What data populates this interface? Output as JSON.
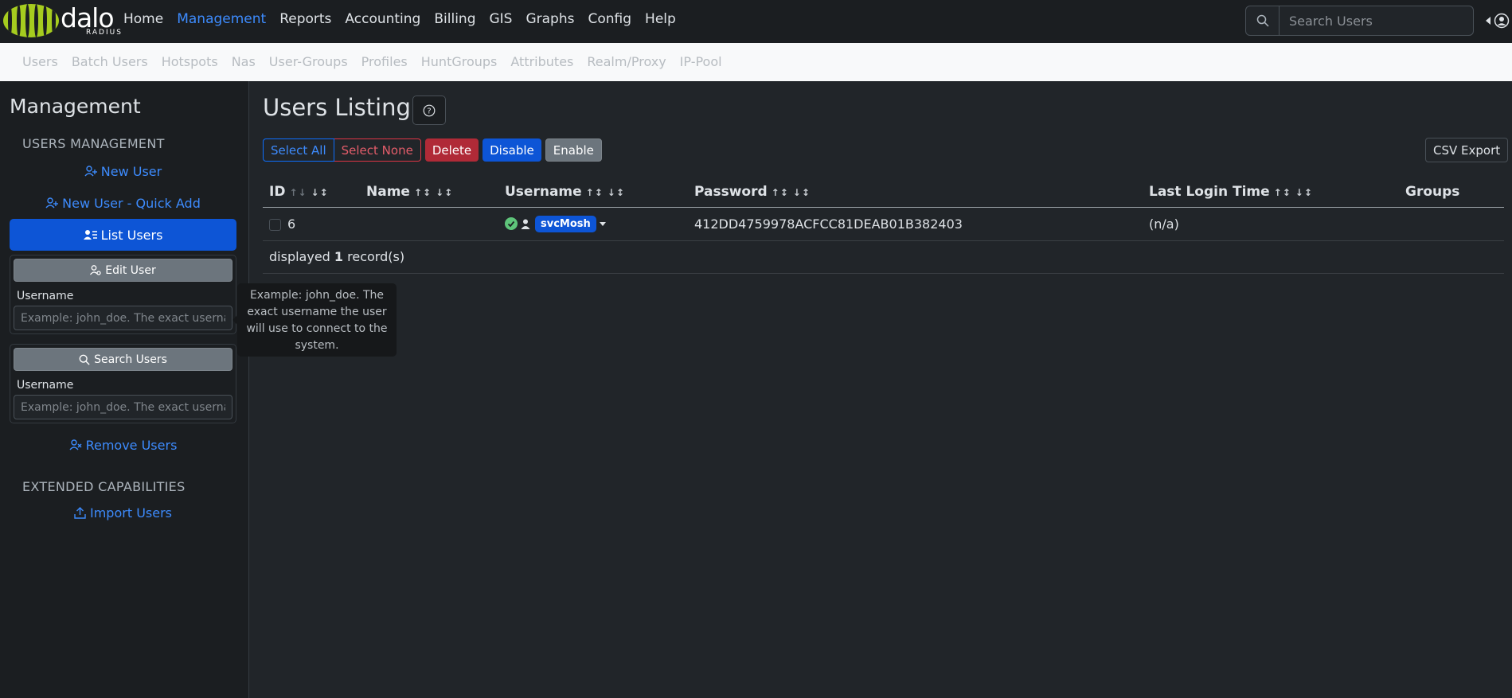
{
  "brand": {
    "word": "dalo",
    "sub": "RADIUS"
  },
  "nav": {
    "items": [
      "Home",
      "Management",
      "Reports",
      "Accounting",
      "Billing",
      "GIS",
      "Graphs",
      "Config",
      "Help"
    ],
    "active": "Management"
  },
  "search": {
    "placeholder": "Search Users"
  },
  "subnav": {
    "items": [
      "Users",
      "Batch Users",
      "Hotspots",
      "Nas",
      "User-Groups",
      "Profiles",
      "HuntGroups",
      "Attributes",
      "Realm/Proxy",
      "IP-Pool"
    ]
  },
  "sidebar": {
    "title": "Management",
    "section_users": "USERS MANAGEMENT",
    "new_user": "New User",
    "new_user_quick": "New User - Quick Add",
    "list_users": "List Users",
    "edit_user": {
      "button": "Edit User",
      "label": "Username",
      "placeholder": "Example: john_doe. The exact username the user will use to connect to the system."
    },
    "search_users": {
      "button": "Search Users",
      "label": "Username",
      "placeholder": "Example: john_doe. The exact username the user will use to connect to the system."
    },
    "remove_users": "Remove Users",
    "section_extended": "EXTENDED CAPABILITIES",
    "import_users": "Import Users"
  },
  "tooltip": "Example: john_doe. The exact username the user will use to connect to the system.",
  "main": {
    "title": "Users Listing",
    "actions": {
      "select_all": "Select All",
      "select_none": "Select None",
      "delete": "Delete",
      "disable": "Disable",
      "enable": "Enable"
    },
    "csv_export": "CSV Export",
    "table": {
      "headers": {
        "id": "ID",
        "name": "Name",
        "username": "Username",
        "password": "Password",
        "last_login": "Last Login Time",
        "groups": "Groups"
      },
      "rows": [
        {
          "id": "6",
          "name": "",
          "username": "svcMosh",
          "password": "412DD4759978ACFCC81DEAB01B382403",
          "last_login": "(n/a)",
          "groups": ""
        }
      ],
      "summary_prefix": "displayed",
      "summary_count": "1",
      "summary_suffix": "record(s)"
    }
  },
  "colors": {
    "accent": "#3d8bfd",
    "primary": "#0d55d6",
    "danger": "#b02a37",
    "success": "#5ec47a",
    "logo": "#a6cc1f"
  }
}
